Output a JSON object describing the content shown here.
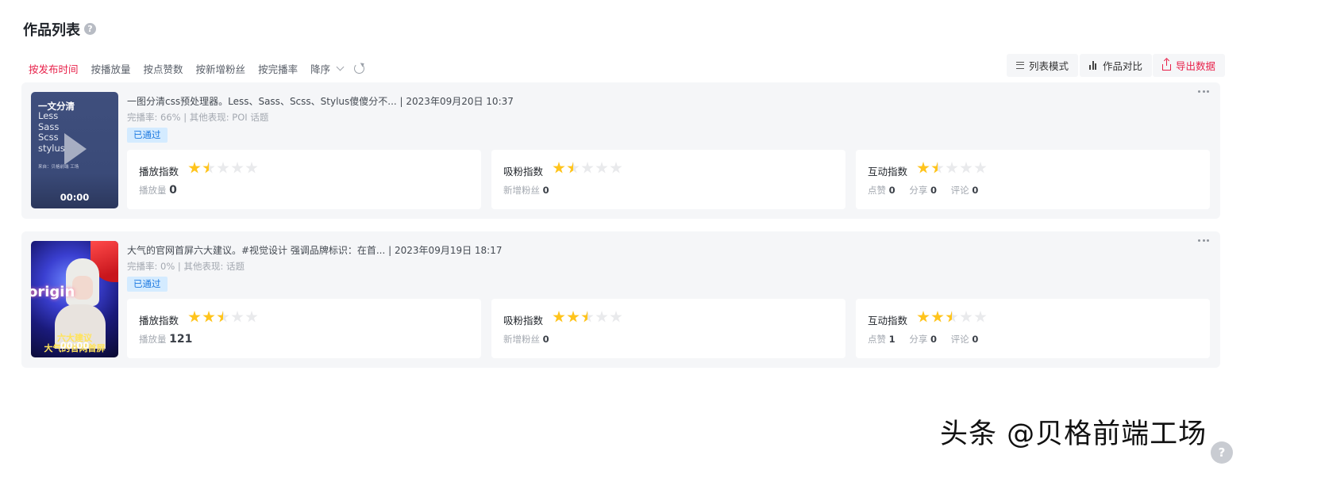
{
  "page": {
    "title": "作品列表"
  },
  "sort": {
    "options": [
      "按发布时间",
      "按播放量",
      "按点赞数",
      "按新增粉丝",
      "按完播率"
    ],
    "active": "按发布时间",
    "order": "降序"
  },
  "toolbar": {
    "list_mode": "列表模式",
    "compare": "作品对比",
    "export": "导出数据"
  },
  "works": [
    {
      "thumb_heading": "一文分清",
      "thumb_lines": [
        "Less",
        "Sass",
        "Scss",
        "stylus"
      ],
      "thumb_source": "来自：贝格前端 工场",
      "duration": "00:00",
      "title": "一图分清css预处理器。Less、Sass、Scss、Stylus傻傻分不...",
      "date": "| 2023年09月20日 10:37",
      "sub": "完播率: 66% | 其他表现: POI 话题",
      "status": "已通过",
      "play_index": {
        "label": "播放指数",
        "stars": 1.5,
        "stat_label": "播放量",
        "stat_value": "0"
      },
      "fans_index": {
        "label": "吸粉指数",
        "stars": 1.5,
        "stat_label": "新增粉丝",
        "stat_value": "0"
      },
      "interact_index": {
        "label": "互动指数",
        "stars": 1.5,
        "likes_label": "点赞",
        "likes": "0",
        "shares_label": "分享",
        "shares": "0",
        "comments_label": "评论",
        "comments": "0"
      }
    },
    {
      "thumb_neon": "origin",
      "thumb_caption1": "六大建议",
      "thumb_caption2": "大气的官网首屏",
      "duration": "00:00",
      "title": "大气的官网首屏六大建议。#视觉设计 强调品牌标识：在首...",
      "date": "| 2023年09月19日 18:17",
      "sub": "完播率: 0% | 其他表现: 话题",
      "status": "已通过",
      "play_index": {
        "label": "播放指数",
        "stars": 2.5,
        "stat_label": "播放量",
        "stat_value": "121"
      },
      "fans_index": {
        "label": "吸粉指数",
        "stars": 2.5,
        "stat_label": "新增粉丝",
        "stat_value": "0"
      },
      "interact_index": {
        "label": "互动指数",
        "stars": 2.5,
        "likes_label": "点赞",
        "likes": "1",
        "shares_label": "分享",
        "shares": "0",
        "comments_label": "评论",
        "comments": "0"
      }
    }
  ],
  "watermark": "头条 @贝格前端工场",
  "icons": [
    "help-icon",
    "chevron-down-icon",
    "refresh-icon",
    "list-icon",
    "bar-chart-icon",
    "export-icon",
    "play-icon",
    "more-icon",
    "star-icon"
  ],
  "colors": {
    "accent": "#e8214a",
    "badge_bg": "#d4ebff",
    "badge_text": "#1f7ae0",
    "star": "#ffc41c"
  }
}
